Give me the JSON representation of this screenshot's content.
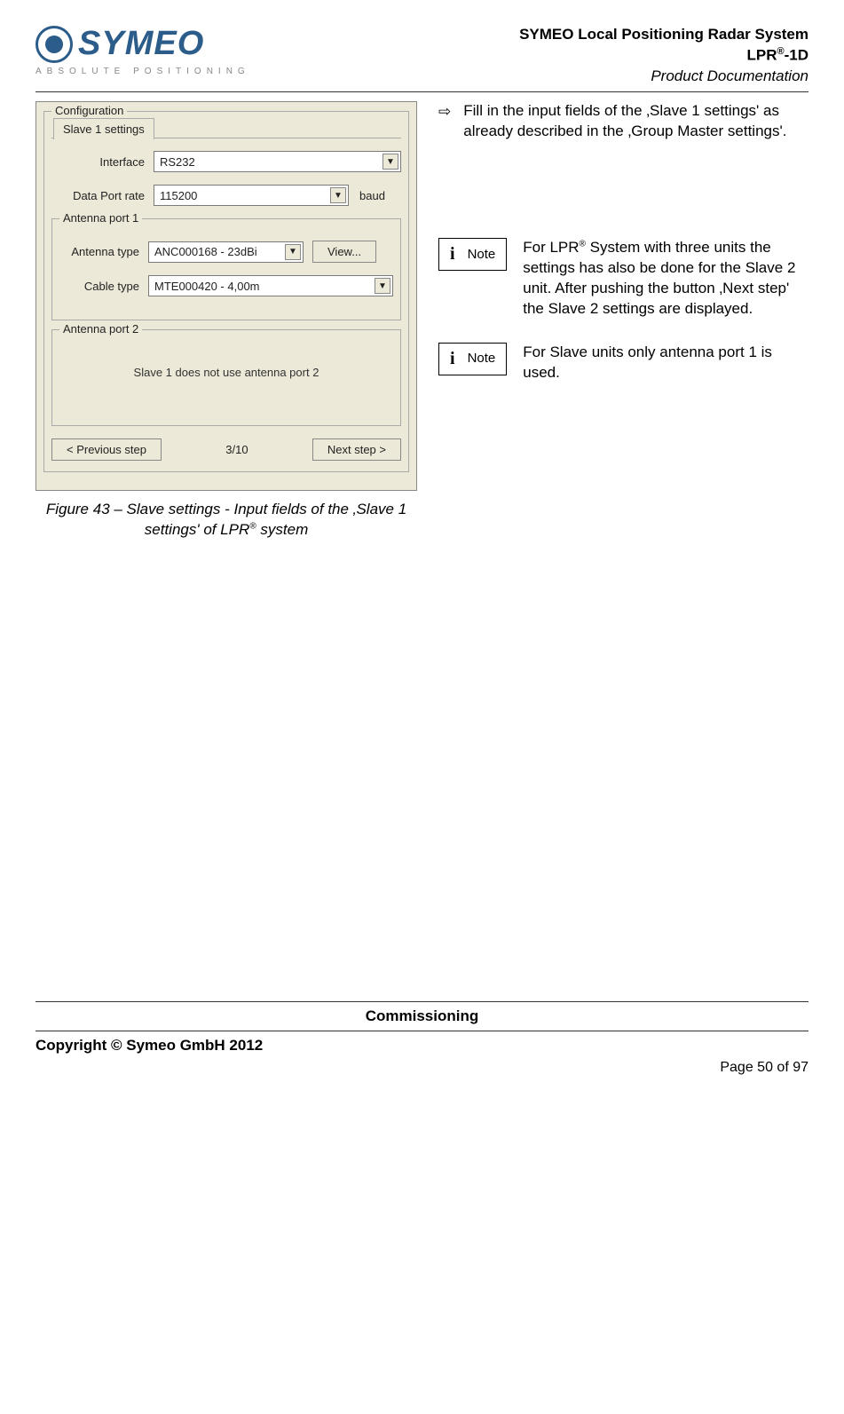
{
  "header": {
    "logo_text": "SYMEO",
    "logo_sub": "ABSOLUTE POSITIONING",
    "line1": "SYMEO Local Positioning Radar System",
    "line2_pre": "LPR",
    "line2_reg": "®",
    "line2_post": "-1D",
    "line3": "Product Documentation"
  },
  "dialog": {
    "group_title": "Configuration",
    "tab": "Slave 1 settings",
    "rows": {
      "interface_label": "Interface",
      "interface_value": "RS232",
      "dataport_label": "Data Port rate",
      "dataport_value": "115200",
      "dataport_unit": "baud",
      "ap1_title": "Antenna port 1",
      "antenna_type_label": "Antenna type",
      "antenna_type_value": "ANC000168  -  23dBi",
      "view_btn": "View...",
      "cable_type_label": "Cable type",
      "cable_type_value": "MTE000420  -  4,00m",
      "ap2_title": "Antenna port 2",
      "ap2_placeholder": "Slave 1 does not use antenna port 2"
    },
    "nav": {
      "prev": "< Previous step",
      "step": "3/10",
      "next": "Next step >"
    }
  },
  "caption": {
    "pre": "Figure 43 – Slave settings - Input fields of the ‚Slave 1 settings' of LPR",
    "reg": "®",
    "post": " system"
  },
  "right": {
    "instruction": "Fill in the input fields of the ‚Slave 1 settings' as already described in the ‚Group Master settings'.",
    "note_label": "Note",
    "note1_pre": "For LPR",
    "note1_reg": "®",
    "note1_post": " System with three units the settings has also be done for the Slave 2 unit. After pushing the  button ‚Next step' the Slave 2 settings are displayed.",
    "note2": "For Slave units only antenna port 1 is used."
  },
  "footer": {
    "section": "Commissioning",
    "copyright": "Copyright © Symeo GmbH 2012",
    "page": "Page 50 of 97"
  }
}
